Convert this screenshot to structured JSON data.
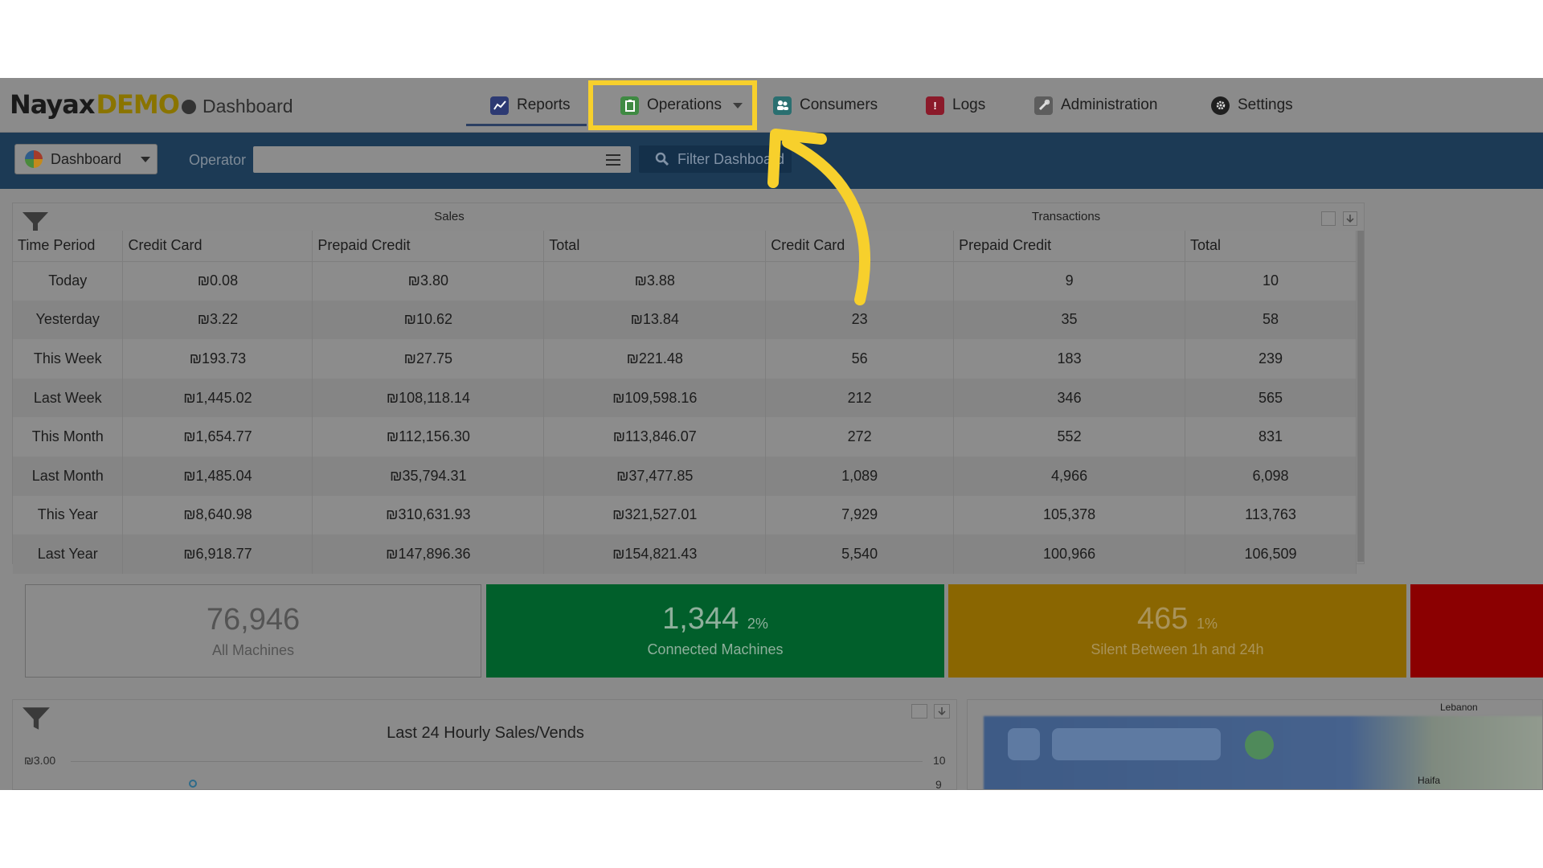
{
  "brand": {
    "name": "Nayax",
    "edition": "DEMO"
  },
  "breadcrumb": "Dashboard",
  "nav": {
    "reports": "Reports",
    "operations": "Operations",
    "consumers": "Consumers",
    "logs": "Logs",
    "administration": "Administration",
    "settings": "Settings"
  },
  "filterbar": {
    "dashboard_label": "Dashboard",
    "operator_label": "Operator",
    "operator_value": "",
    "filter_button": "Filter Dashboard"
  },
  "sales_table": {
    "group_sales": "Sales",
    "group_transactions": "Transactions",
    "columns": [
      "Time Period",
      "Credit Card",
      "Prepaid Credit",
      "Total",
      "Credit Card",
      "Prepaid Credit",
      "Total"
    ],
    "rows": [
      [
        "Today",
        "₪0.08",
        "₪3.80",
        "₪3.88",
        "",
        "9",
        "10"
      ],
      [
        "Yesterday",
        "₪3.22",
        "₪10.62",
        "₪13.84",
        "23",
        "35",
        "58"
      ],
      [
        "This Week",
        "₪193.73",
        "₪27.75",
        "₪221.48",
        "56",
        "183",
        "239"
      ],
      [
        "Last Week",
        "₪1,445.02",
        "₪108,118.14",
        "₪109,598.16",
        "212",
        "346",
        "565"
      ],
      [
        "This Month",
        "₪1,654.77",
        "₪112,156.30",
        "₪113,846.07",
        "272",
        "552",
        "831"
      ],
      [
        "Last Month",
        "₪1,485.04",
        "₪35,794.31",
        "₪37,477.85",
        "1,089",
        "4,966",
        "6,098"
      ],
      [
        "This Year",
        "₪8,640.98",
        "₪310,631.93",
        "₪321,527.01",
        "7,929",
        "105,378",
        "113,763"
      ],
      [
        "Last Year",
        "₪6,918.77",
        "₪147,896.36",
        "₪154,821.43",
        "5,540",
        "100,966",
        "106,509"
      ]
    ]
  },
  "tiles": {
    "all": {
      "value": "76,946",
      "label": "All Machines"
    },
    "connected": {
      "value": "1,344",
      "pct": "2%",
      "label": "Connected Machines"
    },
    "silent": {
      "value": "465",
      "pct": "1%",
      "label": "Silent Between 1h and 24h"
    }
  },
  "hourly_chart": {
    "title": "Last 24 Hourly Sales/Vends",
    "y_left_top": "₪3.00",
    "y_right_top": "10",
    "y_right_second": "9"
  },
  "map": {
    "label_city": "Haifa",
    "label_top": "Lebanon"
  },
  "colors": {
    "highlight": "#f7d02c",
    "connected": "#015f2b",
    "silent": "#8a6601",
    "offline": "#8b0001",
    "filterbar": "#1c3a55"
  }
}
